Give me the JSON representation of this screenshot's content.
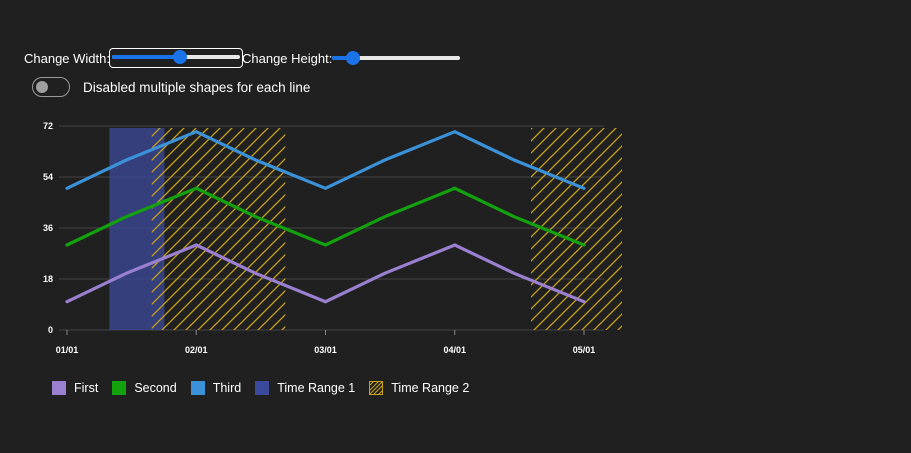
{
  "controls": {
    "width_label": "Change Width:",
    "width_value": 0.55,
    "height_label": "Change Height:",
    "height_value": 0.16,
    "toggle_label": "Disabled multiple shapes for each line",
    "toggle_on": false
  },
  "colors": {
    "first": "#9b7fd0",
    "second": "#13a10e",
    "third": "#3b92d8",
    "range1": "#3b4a9b",
    "range2": "#c8a21e",
    "grid": "#444444",
    "axis_text": "#ffffff"
  },
  "chart_data": {
    "type": "line",
    "x": [
      "01/01",
      "01/15",
      "02/01",
      "02/15",
      "03/01",
      "03/15",
      "04/01",
      "04/15",
      "05/01"
    ],
    "x_tick_labels": [
      "01/01",
      "02/01",
      "03/01",
      "04/01",
      "05/01"
    ],
    "ylim": [
      0,
      72
    ],
    "y_ticks": [
      0,
      18,
      36,
      54,
      72
    ],
    "grid": true,
    "legend_position": "bottom-left",
    "series": [
      {
        "name": "First",
        "values": [
          10,
          20,
          30,
          20,
          10,
          20,
          30,
          20,
          10
        ]
      },
      {
        "name": "Second",
        "values": [
          30,
          40,
          50,
          40,
          30,
          40,
          50,
          40,
          30
        ]
      },
      {
        "name": "Third",
        "values": [
          50,
          60,
          70,
          60,
          50,
          60,
          70,
          60,
          50
        ]
      }
    ],
    "ranges": [
      {
        "name": "Time Range 1",
        "style": "solid",
        "start": "01/11",
        "end": "01/24"
      },
      {
        "name": "Time Range 2",
        "style": "hatched",
        "start": "01/21",
        "end": "02/22"
      },
      {
        "name": "Time Range 2",
        "style": "hatched",
        "start": "04/19",
        "end": "05/10"
      }
    ]
  },
  "legend": [
    {
      "label": "First"
    },
    {
      "label": "Second"
    },
    {
      "label": "Third"
    },
    {
      "label": "Time Range 1"
    },
    {
      "label": "Time Range 2"
    }
  ]
}
